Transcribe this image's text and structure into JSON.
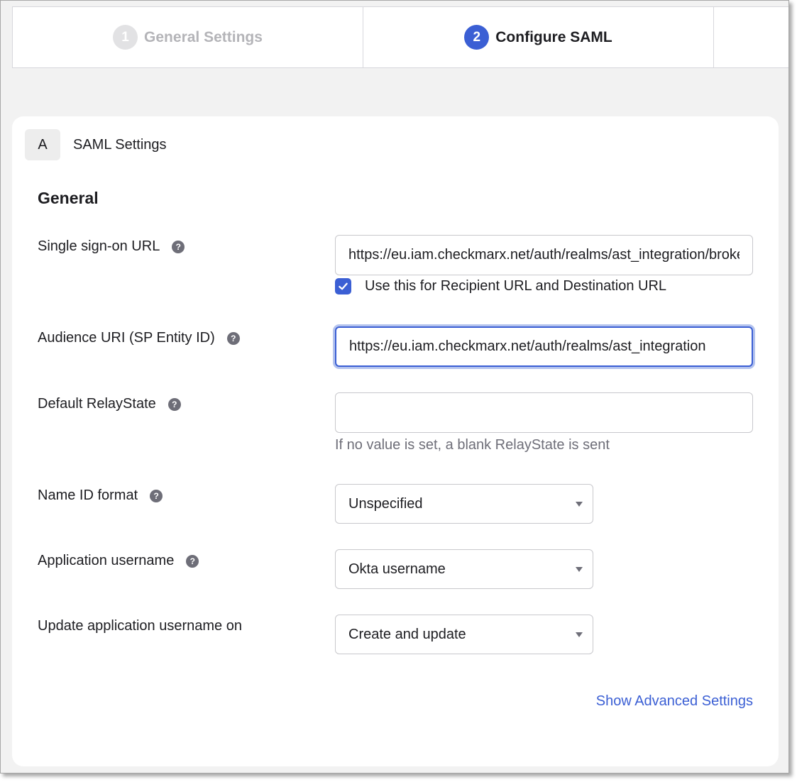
{
  "stepper": {
    "steps": [
      {
        "number": "1",
        "label": "General Settings",
        "state": "inactive"
      },
      {
        "number": "2",
        "label": "Configure SAML",
        "state": "active"
      }
    ]
  },
  "section": {
    "badge": "A",
    "title": "SAML Settings"
  },
  "general": {
    "title": "General",
    "sso_url": {
      "label": "Single sign-on URL",
      "value": "https://eu.iam.checkmarx.net/auth/realms/ast_integration/broker/okta/endpoint"
    },
    "recipient_checkbox": {
      "label": "Use this for Recipient URL and Destination URL",
      "checked": true
    },
    "audience_uri": {
      "label": "Audience URI (SP Entity ID)",
      "value": "https://eu.iam.checkmarx.net/auth/realms/ast_integration"
    },
    "relay_state": {
      "label": "Default RelayState",
      "value": "",
      "hint": "If no value is set, a blank RelayState is sent"
    },
    "name_id_format": {
      "label": "Name ID format",
      "selected": "Unspecified"
    },
    "app_username": {
      "label": "Application username",
      "selected": "Okta username"
    },
    "update_username": {
      "label": "Update application username on",
      "selected": "Create and update"
    },
    "advanced_link": "Show Advanced Settings"
  },
  "colors": {
    "accent": "#3b5fd4",
    "background": "#f2f2f2",
    "card": "#ffffff"
  }
}
